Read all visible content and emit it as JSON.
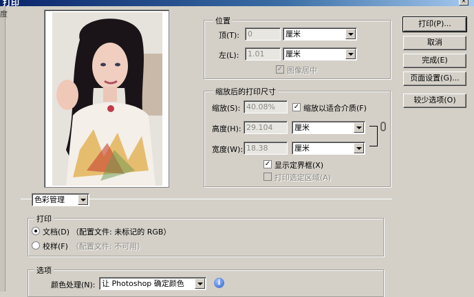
{
  "window": {
    "title": "打印",
    "close_glyph": "×"
  },
  "left_strip_char": "度",
  "position": {
    "legend": "位置",
    "top_label": "顶(T):",
    "top_value": "0",
    "top_unit": "厘米",
    "left_label": "左(L):",
    "left_value": "1.01",
    "left_unit": "厘米",
    "center_label": "图像居中",
    "center_checked": true
  },
  "scaled": {
    "legend": "缩放后的打印尺寸",
    "scale_label": "缩放(S):",
    "scale_value": "40.08%",
    "fit_label": "缩放以适合介质(F)",
    "fit_checked": true,
    "height_label": "高度(H):",
    "height_value": "29.104",
    "height_unit": "厘米",
    "width_label": "宽度(W):",
    "width_value": "18.38",
    "width_unit": "厘米",
    "bbox_label": "显示定界框(X)",
    "bbox_checked": true,
    "print_area_label": "打印选定区域(A)",
    "print_area_checked": false
  },
  "buttons": {
    "print": "打印(P)...",
    "cancel": "取消",
    "done": "完成(E)",
    "page_setup": "页面设置(G)...",
    "fewer_options": "较少选项(O)"
  },
  "color_mgmt": {
    "dropdown_value": "色彩管理",
    "print_legend": "打印",
    "document_label": "文档(D)",
    "document_profile": "（配置文件: 未标记的 RGB）",
    "proof_label": "校样(F)",
    "proof_profile": "（配置文件: 不可用）",
    "options_legend": "选项",
    "color_handling_label": "颜色处理(N):",
    "color_handling_value": "让 Photoshop 确定颜色",
    "info_glyph": "i"
  },
  "check_glyph": "✓"
}
